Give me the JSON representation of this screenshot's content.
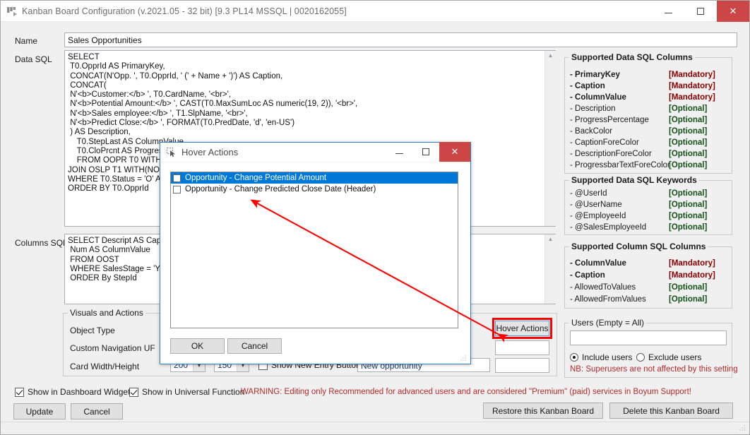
{
  "window": {
    "title": "Kanban Board Configuration (v.2021.05 - 32 bit) [9.3 PL14 MSSQL | 0020162055]",
    "icon": "kanban-board-icon",
    "minimize_label": "",
    "maximize_label": "",
    "close_label": "✕"
  },
  "form": {
    "name_label": "Name",
    "name_value": "Sales Opportunities",
    "data_sql_label": "Data SQL",
    "data_sql_value": "SELECT\n T0.OpprId AS PrimaryKey,\n CONCAT(N'Opp. ', T0.OpprId, ' (' + Name + ')') AS Caption,\n CONCAT(\n N'<b>Customer:</b> ', T0.CardName, '<br>',\n N'<b>Potential Amount:</b> ', CAST(T0.MaxSumLoc AS numeric(19, 2)), '<br>',\n N'<b>Sales employee:</b> ', T1.SlpName, '<br>',\n N'<b>Predict Close:</b> ', FORMAT(T0.PredDate, 'd', 'en-US')\n ) AS Description,\n    T0.StepLast AS ColumnValue,\n    T0.CloPrcnt AS Progress\n    FROM OOPR T0 WITH(\nJOIN OSLP T1 WITH(NOL\nWHERE T0.Status = 'O' A\nORDER BY T0.OpprId",
    "columns_sql_label": "Columns SQL",
    "columns_sql_value": "SELECT Descript AS Capti\n Num AS ColumnValue\n FROM OOST\n WHERE SalesStage = 'Y' \n ORDER By StepId"
  },
  "visuals": {
    "group_title": "Visuals and Actions",
    "object_type_label": "Object Type",
    "custom_nav_label": "Custom Navigation UF",
    "card_size_label": "Card Width/Height",
    "card_width": "200",
    "card_height": "150",
    "show_new_entry_label": "Show New Entry Button",
    "new_entry_value": "New opportunity",
    "hover_actions_button": "Hover Actions"
  },
  "data_sql_columns": {
    "group_title": "Supported Data SQL Columns",
    "rows": [
      {
        "name": "- PrimaryKey",
        "tag": "[Mandatory]",
        "kind": "mandatory"
      },
      {
        "name": "- Caption",
        "tag": "[Mandatory]",
        "kind": "mandatory"
      },
      {
        "name": "- ColumnValue",
        "tag": "[Mandatory]",
        "kind": "mandatory"
      },
      {
        "name": "- Description",
        "tag": "[Optional]",
        "kind": "optional"
      },
      {
        "name": "- ProgressPercentage",
        "tag": "[Optional]",
        "kind": "optional"
      },
      {
        "name": "- BackColor",
        "tag": "[Optional]",
        "kind": "optional"
      },
      {
        "name": "- CaptionForeColor",
        "tag": "[Optional]",
        "kind": "optional"
      },
      {
        "name": "- DescriptionForeColor",
        "tag": "[Optional]",
        "kind": "optional"
      },
      {
        "name": "- ProgressbarTextForeColor",
        "tag": "[Optional]",
        "kind": "optional"
      }
    ]
  },
  "data_sql_keywords": {
    "group_title": "Supported Data SQL Keywords",
    "rows": [
      {
        "name": "- @UserId",
        "tag": "[Optional]",
        "kind": "optional"
      },
      {
        "name": "- @UserName",
        "tag": "[Optional]",
        "kind": "optional"
      },
      {
        "name": "- @EmployeeId",
        "tag": "[Optional]",
        "kind": "optional"
      },
      {
        "name": "- @SalesEmployeeId",
        "tag": "[Optional]",
        "kind": "optional"
      }
    ]
  },
  "column_sql_columns": {
    "group_title": "Supported Column SQL Columns",
    "rows": [
      {
        "name": "- ColumnValue",
        "tag": "[Mandatory]",
        "kind": "mandatory"
      },
      {
        "name": "- Caption",
        "tag": "[Mandatory]",
        "kind": "mandatory"
      },
      {
        "name": "- AllowedToValues",
        "tag": "[Optional]",
        "kind": "optional"
      },
      {
        "name": "- AllowedFromValues",
        "tag": "[Optional]",
        "kind": "optional"
      }
    ]
  },
  "users": {
    "group_title": "Users (Empty = All)",
    "input_value": "",
    "include_label": "Include users",
    "exclude_label": "Exclude users",
    "selected": "include",
    "note": "NB: Superusers are not affected by this setting"
  },
  "footer": {
    "show_dashboard_label": "Show in Dashboard Widget",
    "show_dashboard_checked": true,
    "show_universal_label": "Show in Universal Function",
    "show_universal_checked": true,
    "warning": "WARNING: Editing only Recommended for advanced users and are considered \"Premium\" (paid) services in Boyum Support!",
    "update_label": "Update",
    "cancel_label": "Cancel",
    "restore_label": "Restore this Kanban Board",
    "delete_label": "Delete this Kanban Board"
  },
  "dialog": {
    "title": "Hover Actions",
    "icon": "cursor-click-icon",
    "minimize_label": "",
    "maximize_label": "",
    "close_label": "✕",
    "items": [
      {
        "label": "Opportunity - Change Potential Amount",
        "checked": false,
        "selected": true
      },
      {
        "label": "Opportunity - Change Predicted Close Date (Header)",
        "checked": false,
        "selected": false
      }
    ],
    "ok_label": "OK",
    "cancel_label": "Cancel"
  },
  "annotation": {
    "highlight_color": "#ff0000",
    "arrow_color": "#ff0000"
  }
}
